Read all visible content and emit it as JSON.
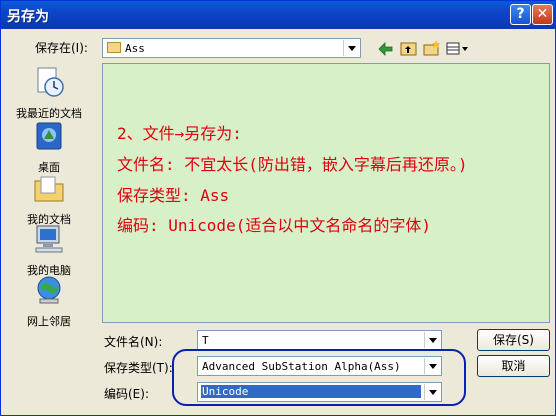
{
  "window": {
    "title": "另存为",
    "help_glyph": "?",
    "close_glyph": "✕"
  },
  "toolbar": {
    "save_in_label": "保存在(I):",
    "save_in_value": "Ass",
    "icons": [
      "back-arrow-icon",
      "up-folder-icon",
      "new-folder-icon",
      "view-menu-icon"
    ]
  },
  "places": [
    {
      "label": "我最近的文档",
      "icon": "recent-documents-icon"
    },
    {
      "label": "桌面",
      "icon": "desktop-icon"
    },
    {
      "label": "我的文档",
      "icon": "my-documents-icon"
    },
    {
      "label": "我的电脑",
      "icon": "my-computer-icon"
    },
    {
      "label": "网上邻居",
      "icon": "network-places-icon"
    }
  ],
  "annotation": {
    "line1": "2、文件→另存为:",
    "line2": "文件名: 不宜太长(防出错，嵌入字幕后再还原。)",
    "line3": "保存类型: Ass",
    "line4": "编码: Unicode(适合以中文名命名的字体)"
  },
  "form": {
    "filename_label": "文件名(N):",
    "filename_value": "T",
    "type_label": "保存类型(T):",
    "type_value": "Advanced SubStation Alpha(Ass)",
    "encoding_label": "编码(E):",
    "encoding_value": "Unicode"
  },
  "buttons": {
    "save": "保存(S)",
    "cancel": "取消"
  },
  "colors": {
    "title_bar": "#0a5bd8",
    "list_bg": "#d7f0c8",
    "annotation": "#e0000f",
    "ellipse": "#0a1fb5"
  }
}
